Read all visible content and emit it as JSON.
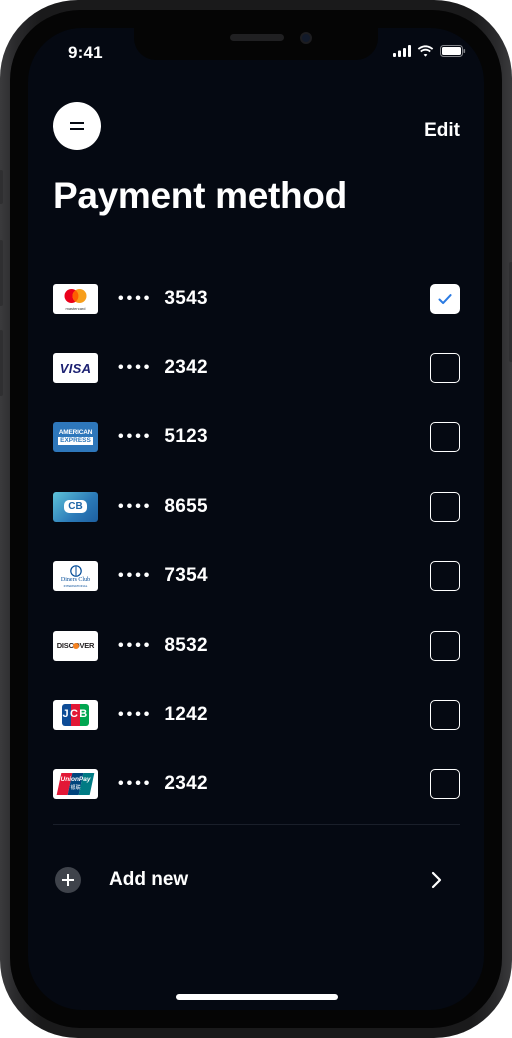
{
  "status_bar": {
    "time": "9:41"
  },
  "header": {
    "menu_icon": "menu-icon",
    "edit_label": "Edit",
    "title": "Payment method"
  },
  "cards": [
    {
      "brand": "mastercard",
      "label": "mastercard",
      "dots": "••••",
      "last4": "3543",
      "checked": true
    },
    {
      "brand": "visa",
      "label": "VISA",
      "dots": "••••",
      "last4": "2342",
      "checked": false
    },
    {
      "brand": "amex",
      "label_top": "AMERICAN",
      "label_bottom": "EXPRESS",
      "dots": "••••",
      "last4": "5123",
      "checked": false
    },
    {
      "brand": "cb",
      "label": "CB",
      "dots": "••••",
      "last4": "8655",
      "checked": false
    },
    {
      "brand": "diners",
      "label_top": "Diners Club",
      "label_bottom": "INTERNATIONAL",
      "dots": "••••",
      "last4": "7354",
      "checked": false
    },
    {
      "brand": "discover",
      "label": "DISCOVER",
      "dots": "••••",
      "last4": "8532",
      "checked": false
    },
    {
      "brand": "jcb",
      "label": "JCB",
      "dots": "••••",
      "last4": "1242",
      "checked": false
    },
    {
      "brand": "unionpay",
      "label": "UnionPay",
      "label_sub": "银联",
      "dots": "••••",
      "last4": "2342",
      "checked": false
    }
  ],
  "add_new": {
    "label": "Add new",
    "icon": "plus-icon",
    "chevron": "chevron-right-icon"
  },
  "colors": {
    "background": "#050912",
    "text": "#ffffff",
    "accent_check": "#2a7ae2"
  }
}
